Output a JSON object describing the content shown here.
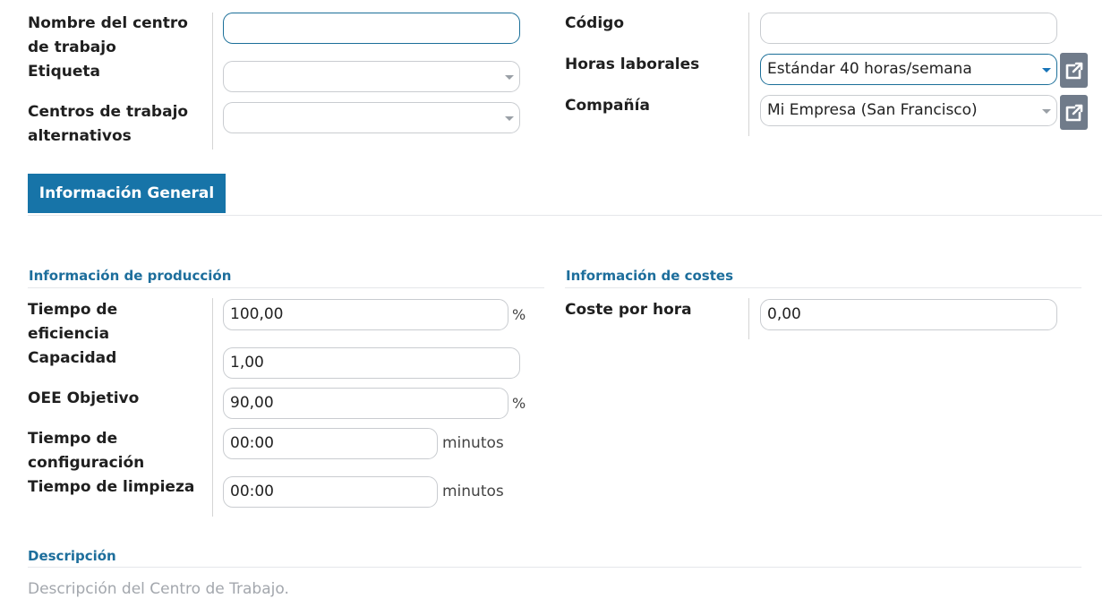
{
  "header_left": {
    "work_center_name": {
      "label": "Nombre del centro de trabajo",
      "value": ""
    },
    "tag": {
      "label": "Etiqueta",
      "value": ""
    },
    "alternative_centers": {
      "label": "Centros de trabajo alternativos",
      "value": ""
    }
  },
  "header_right": {
    "code": {
      "label": "Código",
      "value": ""
    },
    "working_hours": {
      "label": "Horas laborales",
      "value": "Estándar 40 horas/semana"
    },
    "company": {
      "label": "Compañía",
      "value": "Mi Empresa (San Francisco)"
    }
  },
  "tabs": [
    {
      "label": "Información General",
      "active": true
    }
  ],
  "production": {
    "title": "Información de producción",
    "efficiency": {
      "label": "Tiempo de eficiencia",
      "value": "100,00",
      "suffix": "%"
    },
    "capacity": {
      "label": "Capacidad",
      "value": "1,00"
    },
    "oee": {
      "label": "OEE Objetivo",
      "value": "90,00",
      "suffix": "%"
    },
    "setup_time": {
      "label": "Tiempo de configuración",
      "value": "00:00",
      "suffix": "minutos"
    },
    "cleanup_time": {
      "label": "Tiempo de limpieza",
      "value": "00:00",
      "suffix": "minutos"
    }
  },
  "costs": {
    "title": "Información de costes",
    "cost_per_hour": {
      "label": "Coste por hora",
      "value": "0,00"
    }
  },
  "description": {
    "title": "Descripción",
    "placeholder": "Descripción del Centro de Trabajo."
  },
  "colors": {
    "accent": "#1774a8",
    "section_title": "#1d6e9c",
    "external_button": "#707b8a"
  },
  "icons": {
    "external_link": "external-link-icon",
    "dropdown": "caret-down-icon"
  }
}
